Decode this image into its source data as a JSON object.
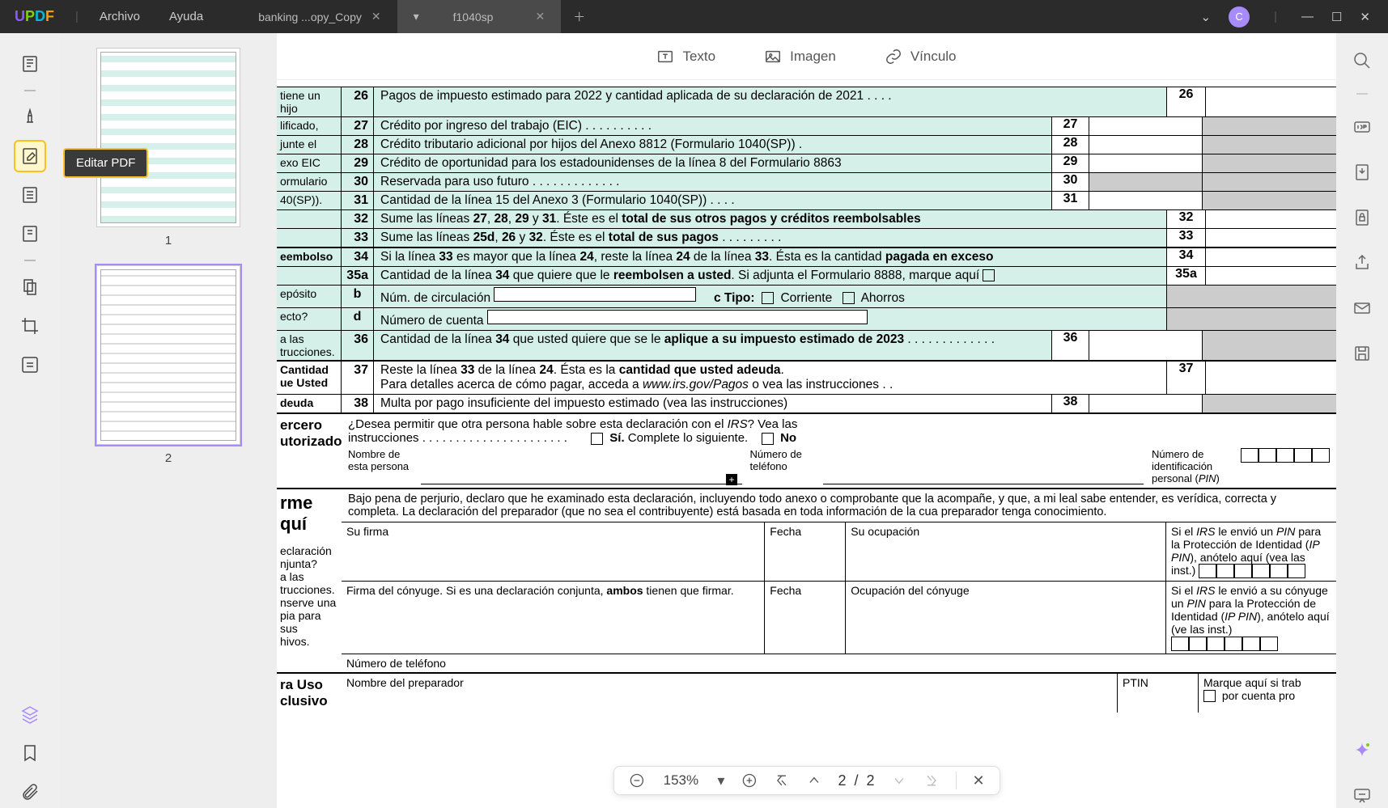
{
  "app": {
    "logo_text": "UPDF",
    "menu_file": "Archivo",
    "menu_help": "Ayuda"
  },
  "tabs": {
    "tab1": "banking ...opy_Copy",
    "tab2": "f1040sp",
    "avatar_letter": "C"
  },
  "tooltip": {
    "edit_pdf": "Editar PDF"
  },
  "thumbs": {
    "p1": "1",
    "p2": "2"
  },
  "edit_toolbar": {
    "text": "Texto",
    "image": "Imagen",
    "link": "Vínculo"
  },
  "doc": {
    "sidecol": {
      "a": "tiene un hijo",
      "b": "lificado,",
      "c": "junte el",
      "d": "exo EIC",
      "e": "ormulario",
      "f": "40(SP)).",
      "g": "eembolso",
      "h": "epósito",
      "i": "ecto?",
      "j": "a las",
      "k": "trucciones.",
      "l": "Cantidad",
      "m": "ue Usted",
      "n": "deuda",
      "o": "ercero",
      "p": "utorizado",
      "q": "rme",
      "r": "quí",
      "s": "eclaración",
      "t": "njunta?",
      "u": "a las",
      "v": "trucciones.",
      "w": "nserve una",
      "x": "pia para sus",
      "y": "hivos.",
      "z": "ra Uso",
      "aa": "clusivo"
    },
    "lines": {
      "l26": {
        "n": "26",
        "t": "Pagos de impuesto estimado para 2022 y cantidad aplicada de su declaración de 2021  .    .    .    .",
        "r": "26"
      },
      "l27": {
        "n": "27",
        "t": "Crédito por ingreso del trabajo (EIC)  .    .    .    .    .    .    .    .    .    .",
        "b": "27"
      },
      "l28": {
        "n": "28",
        "t": "Crédito tributario adicional por hijos del Anexo 8812 (Formulario 1040(SP))  .",
        "b": "28"
      },
      "l29": {
        "n": "29",
        "t": "Crédito de oportunidad para los estadounidenses de la línea 8 del Formulario 8863",
        "b": "29"
      },
      "l30": {
        "n": "30",
        "t": "Reservada para uso futuro   .    .    .    .    .    .    .    .    .    .    .    .    .",
        "b": "30"
      },
      "l31": {
        "n": "31",
        "t": "Cantidad de la línea 15 del Anexo 3 (Formulario 1040(SP))  .    .    .    .",
        "b": "31"
      },
      "l32": {
        "n": "32",
        "t": "Sume las líneas 27, 28, 29 y 31. Éste es el total de sus otros pagos y créditos reembolsables",
        "r": "32"
      },
      "l33": {
        "n": "33",
        "t": "Sume las líneas 25d, 26 y 32. Éste es el total de sus pagos  .    .    .    .    .    .    .    .    .",
        "r": "33"
      },
      "l34": {
        "n": "34",
        "t": "Si la línea 33 es mayor que la línea 24, reste la línea 24 de la línea 33. Ésta es la cantidad pagada en exceso",
        "r": "34"
      },
      "l35a": {
        "n": "35a",
        "t": "Cantidad de la línea 34 que quiere que le reembolsen a usted. Si adjunta el Formulario 8888, marque aquí",
        "r": "35a"
      },
      "l35b": {
        "n": "b",
        "t1": "Núm. de circulación",
        "t2": "c Tipo:",
        "t3": "Corriente",
        "t4": "Ahorros"
      },
      "l35d": {
        "n": "d",
        "t": "Número de cuenta"
      },
      "l36": {
        "n": "36",
        "t": "Cantidad de la línea 34 que usted quiere que se le aplique a su impuesto estimado de 2023  .    .    .    .    .    .    .    .    .    .    .    .    .",
        "b": "36"
      },
      "l37": {
        "n": "37",
        "t": "Reste la línea 33 de la línea 24. Ésta es la cantidad que usted adeuda.",
        "t2": "Para detalles acerca de cómo pagar, acceda a www.irs.gov/Pagos o vea las instrucciones    .    .",
        "r": "37"
      },
      "l38": {
        "n": "38",
        "t": "Multa por pago insuficiente del impuesto estimado (vea las instrucciones)",
        "b": "38"
      }
    },
    "third": {
      "q": "¿Desea permitir que otra persona hable sobre esta declaración con el IRS? Vea las instrucciones    .    .    .    .    .    .    .    .    .    .    .    .    .    .    .    .    .    .    .    .    .    .",
      "yes": "Sí. Complete lo siguiente.",
      "no": "No",
      "name": "Nombre de esta persona",
      "phone": "Número de teléfono",
      "pin": "Número de identificación personal (PIN)"
    },
    "sign": {
      "declare": "Bajo pena de perjurio, declaro que he examinado esta declaración, incluyendo todo anexo o comprobante que la acompañe, y que, a mi leal sabe entender, es verídica, correcta y completa. La declaración del preparador (que no sea el contribuyente) está basada en toda información de la cua preparador tenga conocimiento.",
      "sig": "Su firma",
      "date": "Fecha",
      "occ": "Su ocupación",
      "pin1": "Si el IRS le envió un PIN para la Protección de Identidad (IP PIN), anótelo aquí (vea las inst.)",
      "sig2": "Firma del cónyuge. Si es una declaración conjunta, ambos tienen que firmar.",
      "occ2": "Ocupación del cónyuge",
      "pin2": "Si el IRS le envió a su cónyuge un PIN para la Protección de Identidad (IP PIN), anótelo aquí (ve las inst.)",
      "tel": "Número de teléfono",
      "prep": "Nombre del preparador",
      "ptin": "PTIN",
      "marque": "Marque aquí si trab",
      "porc": "por cuenta pro"
    }
  },
  "bottombar": {
    "zoom": "153%",
    "page_cur": "2",
    "page_sep": "/",
    "page_tot": "2"
  }
}
